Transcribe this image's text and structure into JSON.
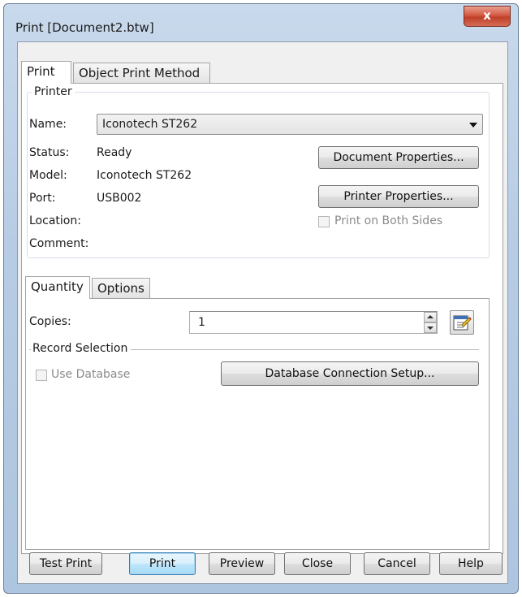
{
  "window": {
    "title": "Print [Document2.btw]",
    "close_glyph": "x"
  },
  "tabs": {
    "print": "Print",
    "object_print_method": "Object Print Method"
  },
  "printer": {
    "group_label": "Printer",
    "name_label": "Name:",
    "name_value": "Iconotech ST262",
    "status_label": "Status:",
    "status_value": "Ready",
    "model_label": "Model:",
    "model_value": "Iconotech ST262",
    "port_label": "Port:",
    "port_value": "USB002",
    "location_label": "Location:",
    "comment_label": "Comment:",
    "document_properties": "Document Properties...",
    "printer_properties": "Printer Properties...",
    "print_both_sides": "Print on Both Sides"
  },
  "subtabs": {
    "quantity": "Quantity",
    "options": "Options"
  },
  "quantity": {
    "copies_label": "Copies:",
    "copies_value": "1",
    "record_selection_label": "Record Selection",
    "use_database": "Use Database",
    "db_setup": "Database Connection Setup..."
  },
  "footer": {
    "test_print": "Test Print",
    "print": "Print",
    "preview": "Preview",
    "close": "Close",
    "cancel": "Cancel",
    "help": "Help"
  },
  "colors": {
    "title_bar": "#b7cce4",
    "close_button": "#c0402a",
    "default_button": "#3c7fb1",
    "dialog_bg": "#f0f0f0"
  },
  "icons": {
    "close": "close-icon",
    "dropdown": "chevron-down-icon",
    "spin": "spinner-icon",
    "edit": "variable-edit-icon"
  }
}
